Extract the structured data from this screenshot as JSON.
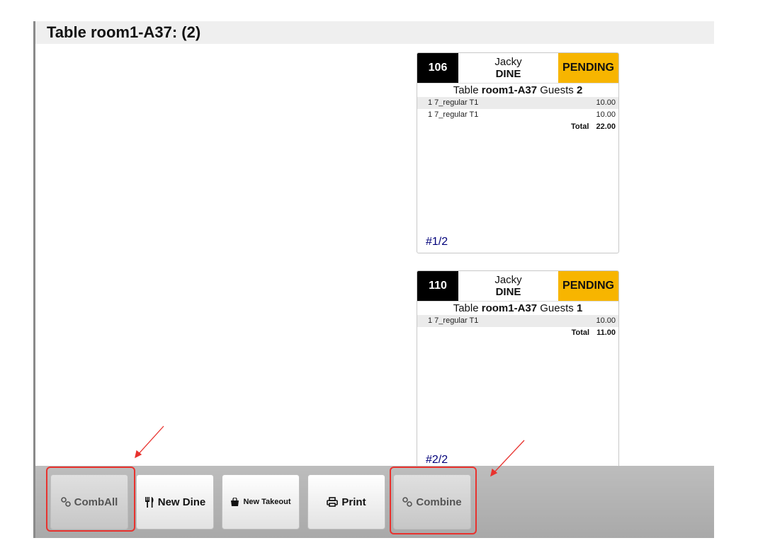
{
  "header": {
    "title": "Table room1-A37: (2)"
  },
  "tickets": [
    {
      "number": "106",
      "server": "Jacky",
      "type": "DINE",
      "status": "PENDING",
      "table_prefix": "Table ",
      "table_name": "room1-A37",
      "guests_prefix": " Guests ",
      "guests": "2",
      "items": [
        {
          "label": "1 7_regular T1",
          "price": "10.00"
        },
        {
          "label": "1 7_regular T1",
          "price": "10.00"
        }
      ],
      "total_label": "Total",
      "total": "22.00",
      "sequence": "#1/2"
    },
    {
      "number": "110",
      "server": "Jacky",
      "type": "DINE",
      "status": "PENDING",
      "table_prefix": "Table ",
      "table_name": "room1-A37",
      "guests_prefix": " Guests ",
      "guests": "1",
      "items": [
        {
          "label": "1 7_regular T1",
          "price": "10.00"
        }
      ],
      "total_label": "Total",
      "total": "11.00",
      "sequence": "#2/2"
    }
  ],
  "toolbar": {
    "comb_all": {
      "label": "CombAll",
      "icon": "link-icon"
    },
    "new_dine": {
      "label": "New Dine",
      "icon": "utensils-icon"
    },
    "new_takeout": {
      "label": "New Takeout",
      "icon": "shopping-bag-icon"
    },
    "print": {
      "label": "Print",
      "icon": "printer-icon"
    },
    "combine": {
      "label": "Combine",
      "icon": "link-icon"
    }
  },
  "colors": {
    "status": "#f7b500",
    "annotation": "#e8322e",
    "sequence": "#00007a"
  }
}
